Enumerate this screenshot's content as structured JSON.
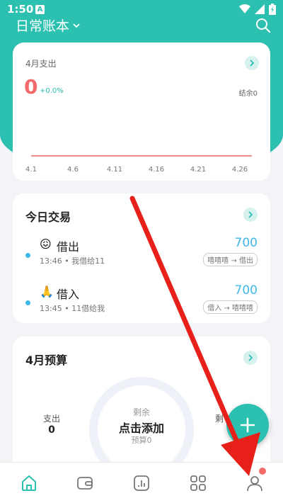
{
  "status_bar": {
    "time": "1:50",
    "badge": "A"
  },
  "header": {
    "book_title": "日常账本"
  },
  "monthly_expense": {
    "title": "4月支出",
    "amount": "0",
    "change": "+0.0%",
    "balance": "结余0"
  },
  "chart_data": {
    "type": "line",
    "x": [
      "4.1",
      "4.6",
      "4.11",
      "4.16",
      "4.21",
      "4.26"
    ],
    "series": [
      {
        "values": [
          0,
          0,
          0,
          0,
          0,
          0
        ]
      }
    ],
    "line_color": "#f28b8b"
  },
  "today": {
    "title": "今日交易",
    "transactions": [
      {
        "emoji": "😖",
        "name": "借出",
        "meta": "13:46 • 我借给11",
        "amount": "700",
        "flow": "嘻嘻嘻 → 借出"
      },
      {
        "emoji": "🙏",
        "name": "借入",
        "meta": "13:45 • 11借给我",
        "amount": "700",
        "flow": "借入 → 嘻嘻嘻"
      }
    ]
  },
  "budget": {
    "title": "4月预算",
    "spent_label": "支出",
    "spent_value": "0",
    "remaining_label": "剩余",
    "add_label": "点击添加",
    "budget_label": "预算0",
    "right_label": "剩"
  },
  "colors": {
    "accent": "#2cc0b1",
    "expense": "#f26a6a",
    "income": "#3fb7e8",
    "arrow": "#e8201a"
  }
}
